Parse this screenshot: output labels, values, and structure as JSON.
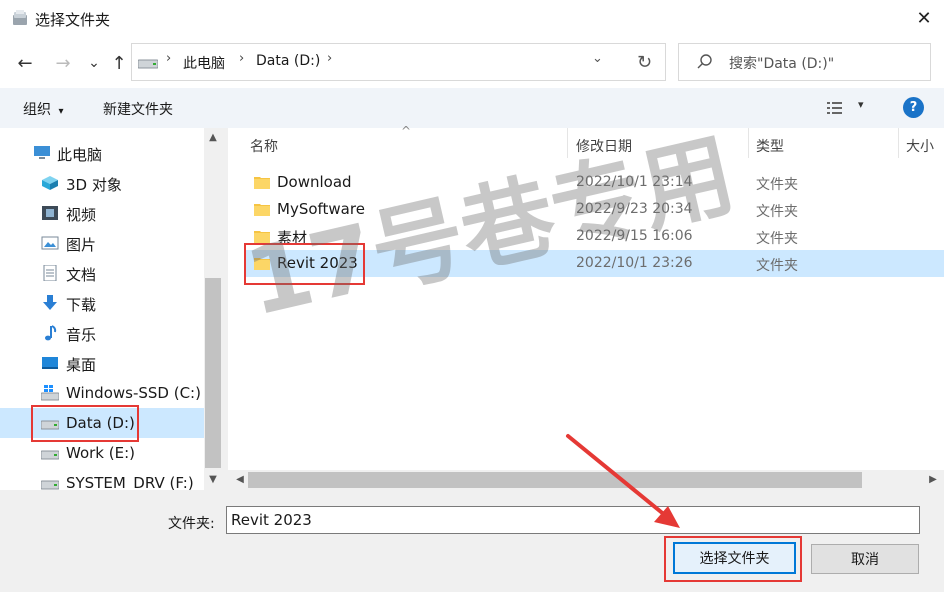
{
  "window": {
    "title": "选择文件夹",
    "close_glyph": "✕"
  },
  "nav": {
    "back_glyph": "←",
    "forward_glyph": "→",
    "recent_glyph": "⌄",
    "up_glyph": "↑",
    "crumbs": [
      "此电脑",
      "Data (D:)"
    ],
    "crumb_sep": "›",
    "dropdown_glyph": "⌄",
    "refresh_glyph": "↻",
    "search_placeholder": "搜索\"Data (D:)\""
  },
  "toolbar": {
    "organize_label": "组织",
    "organize_arrow": "▾",
    "new_folder_label": "新建文件夹",
    "view_arrow": "▾",
    "help_label": "?"
  },
  "sidebar": {
    "items": [
      {
        "label": "此电脑",
        "icon": "pc-icon"
      },
      {
        "label": "3D 对象",
        "icon": "3d-objects-icon"
      },
      {
        "label": "视频",
        "icon": "videos-icon"
      },
      {
        "label": "图片",
        "icon": "pictures-icon"
      },
      {
        "label": "文档",
        "icon": "documents-icon"
      },
      {
        "label": "下载",
        "icon": "downloads-icon"
      },
      {
        "label": "音乐",
        "icon": "music-icon"
      },
      {
        "label": "桌面",
        "icon": "desktop-icon"
      },
      {
        "label": "Windows-SSD (C:)",
        "icon": "windows-drive-icon"
      },
      {
        "label": "Data (D:)",
        "icon": "drive-icon",
        "selected": true
      },
      {
        "label": "Work (E:)",
        "icon": "drive-icon"
      },
      {
        "label": "SYSTEM_DRV (F:)",
        "icon": "drive-icon"
      }
    ],
    "scroll_up": "▲",
    "scroll_down": "▼"
  },
  "list": {
    "columns": {
      "name": "名称",
      "date": "修改日期",
      "type": "类型",
      "size": "大小"
    },
    "sort_glyph": "^",
    "rows": [
      {
        "name": "Download",
        "date": "2022/10/1 23:14",
        "type": "文件夹"
      },
      {
        "name": "MySoftware",
        "date": "2022/9/23 20:34",
        "type": "文件夹"
      },
      {
        "name": "素材",
        "date": "2022/9/15 16:06",
        "type": "文件夹"
      },
      {
        "name": "Revit 2023",
        "date": "2022/10/1 23:26",
        "type": "文件夹",
        "selected": true
      }
    ],
    "scroll_left": "◀",
    "scroll_right": "▶"
  },
  "footer": {
    "folder_label": "文件夹:",
    "folder_value": "Revit 2023",
    "ok_label": "选择文件夹",
    "cancel_label": "取消"
  },
  "watermark": "17号巷专用",
  "colors": {
    "accent": "#0078d7",
    "selection": "#cce8ff",
    "highlight_box": "#e53935",
    "folder": "#f6c443"
  }
}
